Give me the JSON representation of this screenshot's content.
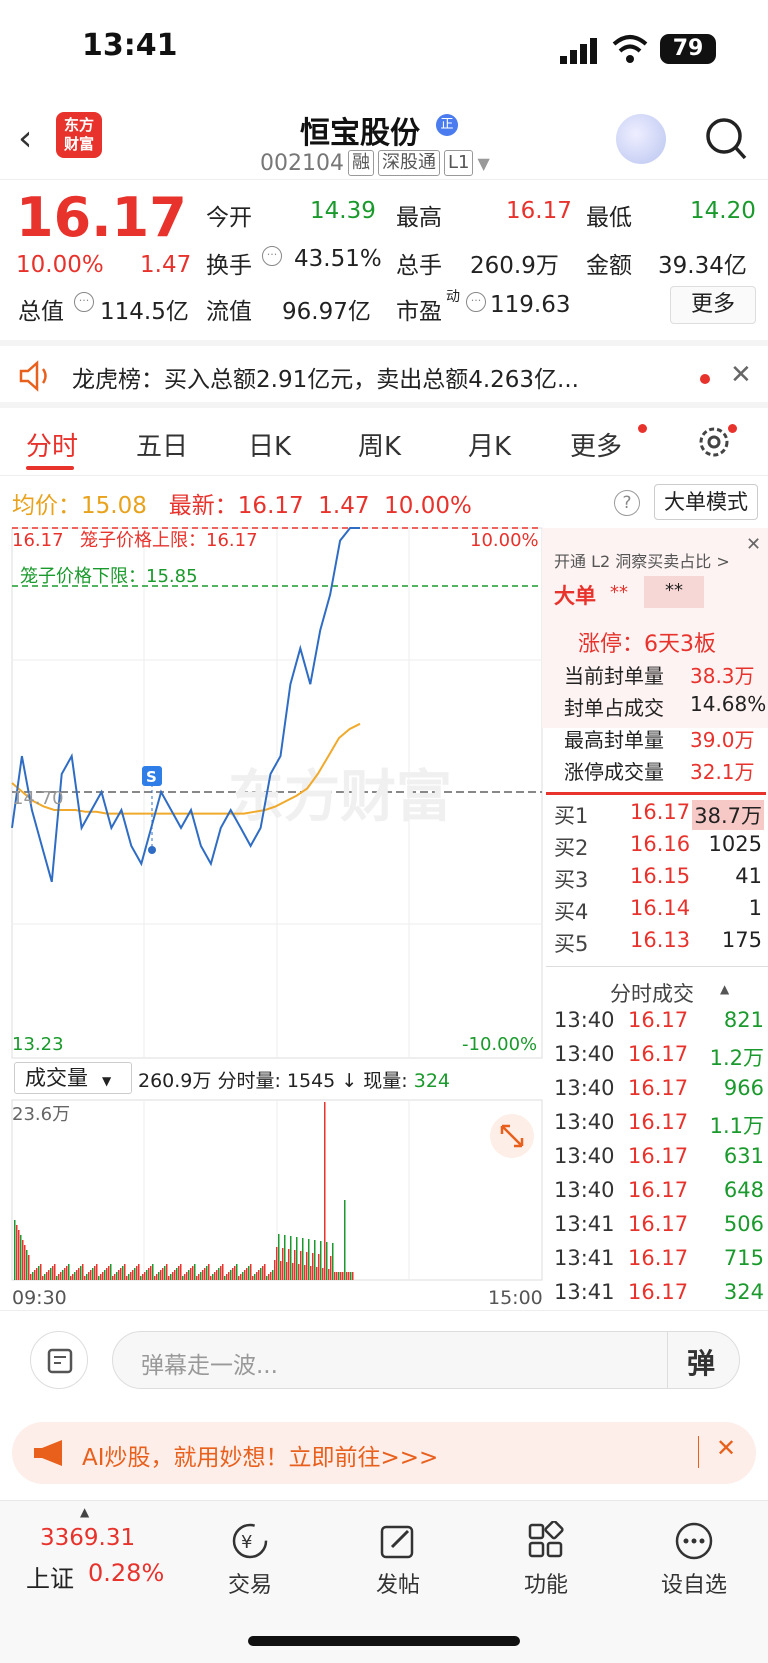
{
  "status": {
    "time": "13:41",
    "battery": "79"
  },
  "header": {
    "logo_line1": "东方",
    "logo_line2": "财富",
    "name": "恒宝股份",
    "badge": "正",
    "code": "002104",
    "tags": [
      "融",
      "深股通",
      "L1"
    ]
  },
  "quote": {
    "price": "16.17",
    "pct": "10.00%",
    "chg": "1.47",
    "open_label": "今开",
    "open": "14.39",
    "high_label": "最高",
    "high": "16.17",
    "low_label": "最低",
    "low": "14.20",
    "turnover_label": "换手",
    "turnover": "43.51%",
    "vol_label": "总手",
    "vol": "260.9万",
    "amount_label": "金额",
    "amount": "39.34亿",
    "mcap_label": "总值",
    "mcap": "114.5亿",
    "float_label": "流值",
    "float": "96.97亿",
    "pe_label": "市盈",
    "pe_sup": "动",
    "pe": "119.63",
    "more": "更多"
  },
  "notice": {
    "text": "龙虎榜：买入总额2.91亿元，卖出总额4.263亿..."
  },
  "tabs": [
    "分时",
    "五日",
    "日K",
    "周K",
    "月K",
    "更多"
  ],
  "info": {
    "avg_label": "均价：",
    "avg": "15.08",
    "last_label": "最新：",
    "last": "16.17",
    "chg": "1.47",
    "pct": "10.00%",
    "mode": "大单模式"
  },
  "chart": {
    "top_price": "16.17",
    "upper_label": "笼子价格上限：16.17",
    "lower_label": "笼子价格下限：15.85",
    "top_pct": "10.00%",
    "mid_price": "14.70",
    "bottom_price": "13.23",
    "bottom_pct": "-10.00%",
    "vol_selector": "成交量",
    "vol_summary": "260.9万",
    "minute_vol_label": "分时量:",
    "minute_vol": "1545",
    "now_vol_label": "现量:",
    "now_vol": "324",
    "vol_max": "23.6万",
    "time_start": "09:30",
    "time_end": "15:00",
    "marker": "S"
  },
  "chart_data": {
    "type": "line",
    "ylim": [
      13.23,
      16.17
    ],
    "series": [
      {
        "values": [
          14.5,
          14.9,
          14.6,
          14.4,
          14.2,
          14.8,
          14.9,
          14.5,
          14.6,
          14.7,
          14.5,
          14.6,
          14.4,
          14.3,
          14.5,
          14.7,
          14.6,
          14.5,
          14.6,
          14.4,
          14.3,
          14.5,
          14.6,
          14.5,
          14.4,
          14.5,
          14.8,
          14.9,
          15.3,
          15.5,
          15.3,
          15.6,
          15.8,
          16.1,
          16.17,
          16.17
        ]
      },
      {
        "values": [
          14.75,
          14.7,
          14.65,
          14.62,
          14.6,
          14.6,
          14.6,
          14.59,
          14.59,
          14.58,
          14.58,
          14.58,
          14.58,
          14.58,
          14.58,
          14.58,
          14.58,
          14.58,
          14.58,
          14.58,
          14.58,
          14.58,
          14.58,
          14.59,
          14.6,
          14.62,
          14.65,
          14.68,
          14.72,
          14.8,
          14.9,
          15.0,
          15.05,
          15.08
        ]
      }
    ]
  },
  "panel": {
    "l2": "开通 L2 洞察买卖占比 >",
    "big": "大单",
    "stars": "**",
    "stars2": "**",
    "limit": "涨停：6天3板",
    "seal_label": "当前封单量",
    "seal": "38.3万",
    "ratio_label": "封单占成交",
    "ratio": "14.68%",
    "maxseal_label": "最高封单量",
    "maxseal": "39.0万",
    "limitvol_label": "涨停成交量",
    "limitvol": "32.1万",
    "bids": [
      {
        "label": "买1",
        "price": "16.17",
        "vol": "38.7万"
      },
      {
        "label": "买2",
        "price": "16.16",
        "vol": "1025"
      },
      {
        "label": "买3",
        "price": "16.15",
        "vol": "41"
      },
      {
        "label": "买4",
        "price": "16.14",
        "vol": "1"
      },
      {
        "label": "买5",
        "price": "16.13",
        "vol": "175"
      }
    ],
    "ticks_title": "分时成交",
    "ticks": [
      {
        "t": "13:40",
        "p": "16.17",
        "v": "821"
      },
      {
        "t": "13:40",
        "p": "16.17",
        "v": "1.2万"
      },
      {
        "t": "13:40",
        "p": "16.17",
        "v": "966"
      },
      {
        "t": "13:40",
        "p": "16.17",
        "v": "1.1万"
      },
      {
        "t": "13:40",
        "p": "16.17",
        "v": "631"
      },
      {
        "t": "13:40",
        "p": "16.17",
        "v": "648"
      },
      {
        "t": "13:41",
        "p": "16.17",
        "v": "506"
      },
      {
        "t": "13:41",
        "p": "16.17",
        "v": "715"
      },
      {
        "t": "13:41",
        "p": "16.17",
        "v": "324"
      }
    ]
  },
  "danmu": {
    "placeholder": "弹幕走一波...",
    "btn": "弹"
  },
  "ad": {
    "text": "AI炒股，就用妙想！立即前往>>>"
  },
  "nav": {
    "index_value": "3369.31",
    "index_name": "上证",
    "index_pct": "0.28%",
    "items": [
      "交易",
      "发帖",
      "功能",
      "设自选"
    ]
  }
}
